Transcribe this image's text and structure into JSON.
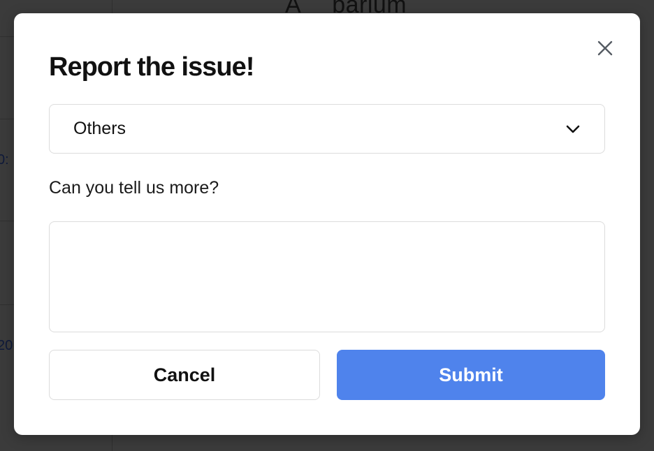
{
  "background": {
    "heading_parts": [
      "A",
      "barium"
    ],
    "cell_text_1": "0:",
    "cell_text_2": "20"
  },
  "modal": {
    "title": "Report the issue!",
    "close_icon": "close-icon",
    "select": {
      "value": "Others",
      "icon": "chevron-down-icon"
    },
    "question_label": "Can you tell us more?",
    "textarea": {
      "value": "",
      "placeholder": ""
    },
    "cancel_label": "Cancel",
    "submit_label": "Submit"
  },
  "colors": {
    "submit_button": "#4f83ec",
    "overlay": "#3b3b3b",
    "modal_background": "#ffffff"
  }
}
